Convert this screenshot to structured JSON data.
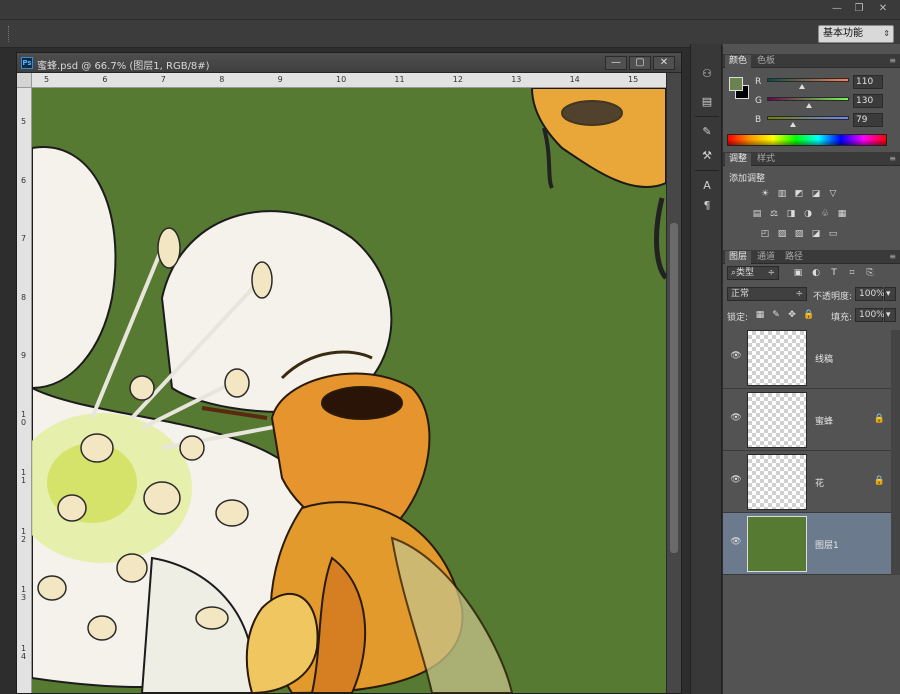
{
  "window": {
    "min_glyph": "—",
    "max_glyph": "❐",
    "close_glyph": "✕"
  },
  "workspace": {
    "label": "基本功能",
    "arrow": "⇕"
  },
  "document": {
    "title": "蜜蜂.psd @ 66.7% (图层1, RGB/8#)",
    "ps_badge": "Ps",
    "controls": {
      "minimize": "—",
      "restore": "▢",
      "close": "✕"
    },
    "ruler_h": [
      "5",
      "6",
      "7",
      "8",
      "9",
      "10",
      "11",
      "12",
      "13",
      "14",
      "15"
    ],
    "ruler_v": [
      "5",
      "6",
      "7",
      "8",
      "9",
      "1\n0",
      "1\n1",
      "1\n2",
      "1\n3",
      "1\n4"
    ]
  },
  "dock_icons": [
    "history-icon",
    "properties-icon",
    "brush-icon",
    "brush-presets-icon",
    "character-icon",
    "paragraph-icon"
  ],
  "color_panel": {
    "tabs": [
      "颜色",
      "色板"
    ],
    "foreground": "#6e824f",
    "background": "#000000",
    "channels": [
      {
        "label": "R",
        "value": "110",
        "fraction": 0.43,
        "gradient": "linear-gradient(90deg,#004f4f,#ff824f)"
      },
      {
        "label": "G",
        "value": "130",
        "fraction": 0.51,
        "gradient": "linear-gradient(90deg,#6e004f,#6eff4f)"
      },
      {
        "label": "B",
        "value": "79",
        "fraction": 0.31,
        "gradient": "linear-gradient(90deg,#6e8200,#6e82ff)"
      }
    ]
  },
  "adjust_panel": {
    "tabs": [
      "调整",
      "样式"
    ],
    "title": "添加调整",
    "row1": [
      "☀",
      "▥",
      "◩",
      "◪",
      "▽"
    ],
    "row2": [
      "▤",
      "⚖",
      "◨",
      "◑",
      "♧",
      "▦"
    ],
    "row3": [
      "◰",
      "▨",
      "▨",
      "◪",
      "▭"
    ]
  },
  "layers_panel": {
    "tabs": [
      "图层",
      "通道",
      "路径"
    ],
    "filter": {
      "label": "⌕类型",
      "arrow": "÷"
    },
    "filter_icons": [
      "▣",
      "◐",
      "T",
      "⌗",
      "⎘"
    ],
    "blend_mode": {
      "value": "正常",
      "arrow": "÷"
    },
    "opacity": {
      "label": "不透明度:",
      "value": "100%",
      "arrow": "▾"
    },
    "lock": {
      "label": "锁定:",
      "icons": [
        "▦",
        "✎",
        "✥",
        "🔒"
      ]
    },
    "fill": {
      "label": "填充:",
      "value": "100%",
      "arrow": "▾"
    },
    "layers": [
      {
        "name": "线稿",
        "locked": false,
        "selected": false,
        "thumb": "transparent",
        "lock_glyph": ""
      },
      {
        "name": "蜜蜂",
        "locked": true,
        "selected": false,
        "thumb": "transparent",
        "lock_glyph": "🔒"
      },
      {
        "name": "花",
        "locked": true,
        "selected": false,
        "thumb": "transparent",
        "lock_glyph": "🔒"
      },
      {
        "name": "图层1",
        "locked": false,
        "selected": true,
        "thumb": "green",
        "lock_glyph": ""
      }
    ],
    "eye_glyph": "👁"
  }
}
